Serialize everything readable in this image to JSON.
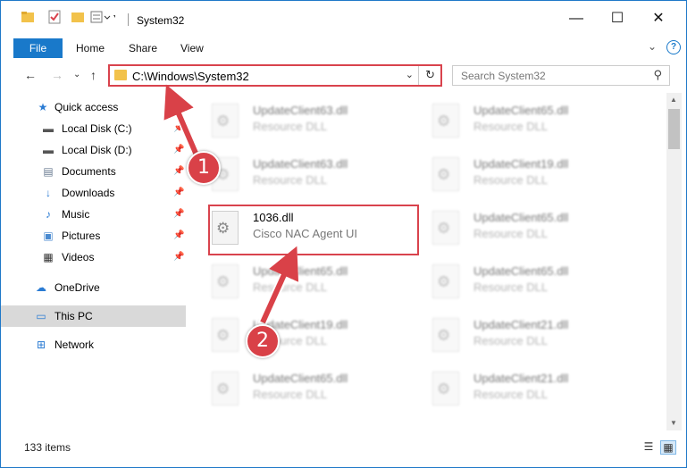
{
  "window": {
    "title": "System32",
    "controls": {
      "minimize": "—",
      "maximize": "☐",
      "close": "✕"
    }
  },
  "ribbon": {
    "tabs": [
      "File",
      "Home",
      "Share",
      "View"
    ],
    "expand_icon": "chevron-down-icon",
    "help_icon": "help-icon"
  },
  "address_bar": {
    "path": "C:\\Windows\\System32",
    "search_placeholder": "Search System32"
  },
  "nav_pane": {
    "items": [
      {
        "label": "Quick access",
        "icon": "star-icon"
      },
      {
        "label": "Local Disk (C:)",
        "icon": "drive-icon",
        "pinned": true
      },
      {
        "label": "Local Disk (D:)",
        "icon": "drive-icon",
        "pinned": true
      },
      {
        "label": "Documents",
        "icon": "documents-icon",
        "pinned": true
      },
      {
        "label": "Downloads",
        "icon": "download-icon",
        "pinned": true
      },
      {
        "label": "Music",
        "icon": "music-icon",
        "pinned": true
      },
      {
        "label": "Pictures",
        "icon": "pictures-icon",
        "pinned": true
      },
      {
        "label": "Videos",
        "icon": "videos-icon",
        "pinned": true
      },
      {
        "label": "OneDrive",
        "icon": "cloud-icon"
      },
      {
        "label": "This PC",
        "icon": "computer-icon",
        "selected": true
      },
      {
        "label": "Network",
        "icon": "network-icon"
      }
    ]
  },
  "files": [
    {
      "name": "UpdateClient63.dll",
      "desc": "Resource DLL"
    },
    {
      "name": "UpdateClient65.dll",
      "desc": "Resource DLL"
    },
    {
      "name": "UpdateClient63.dll",
      "desc": "Resource DLL"
    },
    {
      "name": "UpdateClient19.dll",
      "desc": "Resource DLL"
    },
    {
      "name": "1036.dll",
      "desc": "Cisco NAC Agent UI"
    },
    {
      "name": "UpdateClient65.dll",
      "desc": "Resource DLL"
    },
    {
      "name": "UpdateClient65.dll",
      "desc": "Resource DLL"
    },
    {
      "name": "UpdateClient65.dll",
      "desc": "Resource DLL"
    },
    {
      "name": "UpdateClient19.dll",
      "desc": "Resource DLL"
    },
    {
      "name": "UpdateClient21.dll",
      "desc": "Resource DLL"
    },
    {
      "name": "UpdateClient65.dll",
      "desc": "Resource DLL"
    },
    {
      "name": "UpdateClient21.dll",
      "desc": "Resource DLL"
    }
  ],
  "status_bar": {
    "item_count": "133 items"
  },
  "callouts": [
    "1",
    "2"
  ],
  "colors": {
    "accent": "#1979ca",
    "callout": "#d94148",
    "highlight": "#d9434d"
  }
}
